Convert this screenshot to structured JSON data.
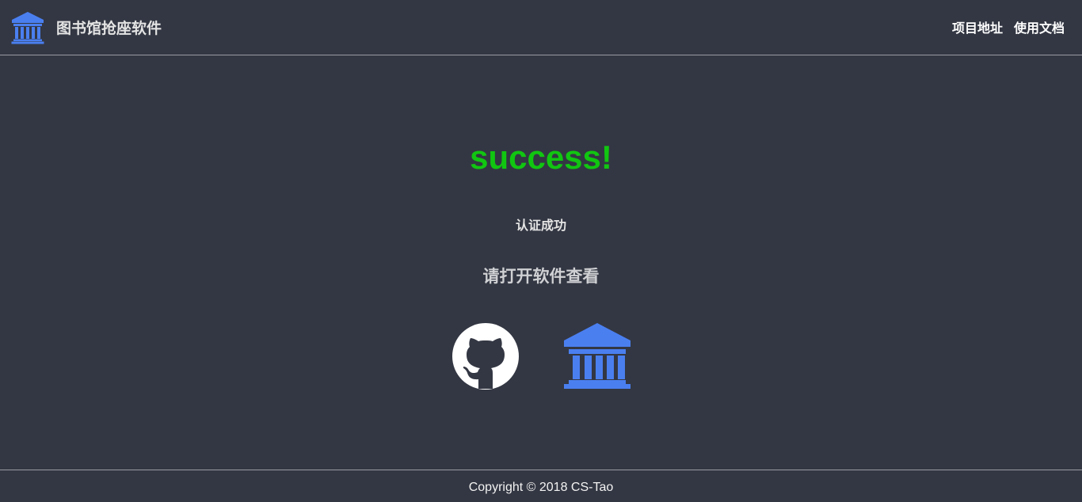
{
  "header": {
    "brand": "图书馆抢座软件",
    "logo_icon": "bank-icon",
    "nav": [
      {
        "label": "项目地址"
      },
      {
        "label": "使用文档"
      }
    ]
  },
  "main": {
    "status": "success!",
    "status_color": "#11c611",
    "message": "认证成功",
    "hint": "请打开软件查看",
    "links": [
      {
        "icon": "github-icon"
      },
      {
        "icon": "bank-icon",
        "color": "#4a7ff0"
      }
    ]
  },
  "footer": {
    "copyright": "Copyright © 2018 CS-Tao"
  }
}
